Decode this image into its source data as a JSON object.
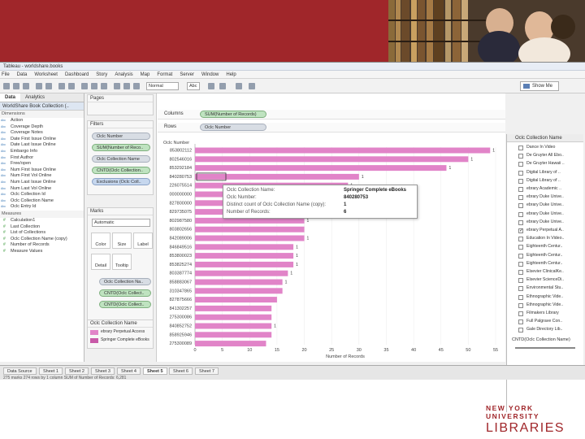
{
  "window": {
    "title": "Tableau - worldshare.books"
  },
  "menu": [
    "File",
    "Data",
    "Worksheet",
    "Dashboard",
    "Story",
    "Analysis",
    "Map",
    "Format",
    "Server",
    "Window",
    "Help"
  ],
  "toolbar": {
    "mark_size_select": "Normal",
    "abc_label": "Abc",
    "show_me": "Show Me"
  },
  "left_pane": {
    "tabs": [
      "Data",
      "Analytics"
    ],
    "source": "WorldShare Book Collection (..",
    "dimensions_label": "Dimensions",
    "dimensions": [
      "Action",
      "Coverage Depth",
      "Coverage Notes",
      "Date First Issue Online",
      "Date Last Issue Online",
      "Embargo Info",
      "First Author",
      "Free/open",
      "Num First Issue Online",
      "Num First Vol Online",
      "Num Last Issue Online",
      "Num Last Vol Online",
      "Oclc Collection Id",
      "Oclc Collection Name",
      "Oclc Entry Id"
    ],
    "measures_label": "Measures",
    "measures": [
      "Calculation1",
      "Last Collection",
      "List of Collections",
      "Oclc Collection Name (copy)",
      "Number of Records",
      "Measure Values"
    ]
  },
  "shelves": {
    "pages": "Pages",
    "filters": "Filters",
    "filter_pills": [
      "Oclc Number",
      "SUM(Number of Reco..",
      "Oclc Collection Name",
      "CNTD(Oclc Collection..",
      "Exclusions (Oclc Coll.."
    ],
    "marks": "Marks",
    "mark_type": "Automatic",
    "mark_buttons": [
      "Color",
      "Size",
      "Label",
      "Detail",
      "Tooltip"
    ],
    "mark_pills": [
      "Oclc Collection Na..",
      "CNTD(Oclc Collect..",
      "CNTD(Oclc Collect.."
    ],
    "columns": "Columns",
    "columns_pill": "SUM(Number of Records)",
    "rows": "Rows",
    "rows_pill": "Oclc Number",
    "legend_title": "Oclc Collection Name",
    "legend_items": [
      "ebrary Perpetual Access",
      "Springer Complete eBooks"
    ]
  },
  "viz": {
    "header": "Oclc Number",
    "xlabel": "Number of Records",
    "tooltip": {
      "rows": [
        {
          "k": "Oclc Collection Name:",
          "v": "Springer Complete eBooks"
        },
        {
          "k": "Oclc Number:",
          "v": "840280753"
        },
        {
          "k": "Distinct count of Oclc Collection Name (copy):",
          "v": "1"
        },
        {
          "k": "Number of Records:",
          "v": "6"
        }
      ]
    }
  },
  "chart_data": {
    "type": "bar",
    "orientation": "horizontal",
    "categories": [
      "853802112",
      "802546016",
      "853292184",
      "840280753",
      "226075514",
      "000000000",
      "827800000",
      "829735075",
      "802987580",
      "803802656",
      "842089006",
      "846849516",
      "853800023",
      "853825274",
      "803387774",
      "858883067",
      "310347865",
      "827875666",
      "841302257",
      "275300086",
      "840852752",
      "858925946",
      "275300089"
    ],
    "values": [
      54,
      50,
      46,
      30,
      28,
      27,
      25,
      25,
      20,
      20,
      20,
      18,
      18,
      18,
      17,
      16,
      16,
      15,
      14,
      14,
      14,
      14,
      13
    ],
    "data_labels": [
      "1",
      "1",
      "1",
      "1",
      "1",
      "",
      "",
      "",
      "1",
      "",
      "1",
      "1",
      "1",
      "1",
      "1",
      "1",
      "",
      "",
      "",
      "",
      "1",
      "",
      ""
    ],
    "xlim": [
      0,
      55
    ],
    "xticks": [
      0,
      5,
      10,
      15,
      20,
      25,
      30,
      35,
      40,
      45,
      50,
      55
    ],
    "color": "#e184c8"
  },
  "right_pane": {
    "title": "Oclc Collection Name",
    "items": [
      "Dance In Video",
      "De Gruyter All Ebo..",
      "De Gruyter Hawaii ..",
      "Digital Library of ..",
      "Digital Library of ..",
      "ebrary Academic ..",
      "ebrary Duke Unive..",
      "ebrary Duke Unive..",
      "ebrary Duke Unive..",
      "ebrary Duke Unive..",
      "ebrary Perpetual A..",
      "Education In Video..",
      "Eighteenth Centur..",
      "Eighteenth Centur..",
      "Eighteenth Centur..",
      "Elsevier ClinicalKe..",
      "Elsevier ScienceDi..",
      "Environmental Stu..",
      "Ethnographic Vide..",
      "Ethnographic Vide..",
      "Filmakers Library",
      "Full Palgrave Con..",
      "Gale Directory Lib.."
    ],
    "checked": [
      10
    ],
    "bottom_title": "CNTD(Oclc Collection Name)"
  },
  "status": {
    "tabs": [
      "Data Source",
      "Sheet 1",
      "Sheet 2",
      "Sheet 3",
      "Sheet 4",
      "Sheet 5",
      "Sheet 6",
      "Sheet 7"
    ],
    "active": "Sheet 5",
    "text": "275 marks   274 rows by 1 column   SUM of Number of Records: 6,281"
  },
  "branding": {
    "line1": "NEW YORK UNIVERSITY",
    "line2": "LIBRARIES",
    "accent": "#a0262a"
  }
}
